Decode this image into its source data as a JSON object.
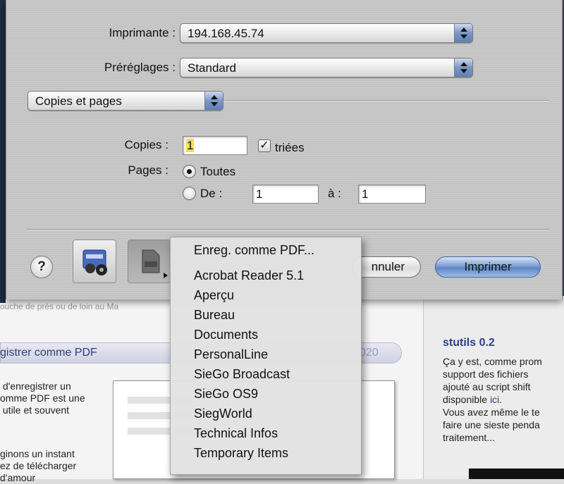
{
  "background": {
    "cut_line": "ouche de près ou de loin au Ma",
    "heading": "gistrer comme PDF",
    "heading_number": "020",
    "para1": " d'enregistrer un\nomme PDF est une\n utile et souvent",
    "para2": "ginons un instant\nez de télécharger\nd'amour",
    "sidebar": {
      "title": "stutils 0.2",
      "text_before_link": "Ça y est, comme prom\nsupport des fichiers\najouté au script shift\ndisponible ",
      "link": "ici",
      "text_after_link": ".\nVous avez même le te\nfaire une sieste penda\ntraitement..."
    }
  },
  "print": {
    "printer_label": "Imprimante :",
    "printer_value": "194.168.45.74",
    "presets_label": "Préréglages :",
    "presets_value": "Standard",
    "section_value": "Copies et pages",
    "copies_label": "Copies :",
    "copies_value": "1",
    "collated_label": "triées",
    "collated_checked": true,
    "pages_label": "Pages :",
    "all_label": "Toutes",
    "from_label": "De :",
    "from_value": "1",
    "to_label": "à :",
    "to_value": "1",
    "help_label": "?",
    "cancel_label": "nnuler",
    "print_label": "Imprimer"
  },
  "pdf_menu": {
    "first": "Enreg. comme PDF...",
    "items": [
      "Acrobat Reader 5.1",
      "Aperçu",
      "Bureau",
      "Documents",
      "PersonalLine",
      "SieGo Broadcast",
      "SieGo OS9",
      "SiegWorld",
      "Technical Infos",
      "Temporary Items"
    ]
  },
  "colors": {
    "accent_blue": "#5f7fb6",
    "link_blue": "#2c3f8a",
    "highlight_yellow": "#f3e04a"
  }
}
